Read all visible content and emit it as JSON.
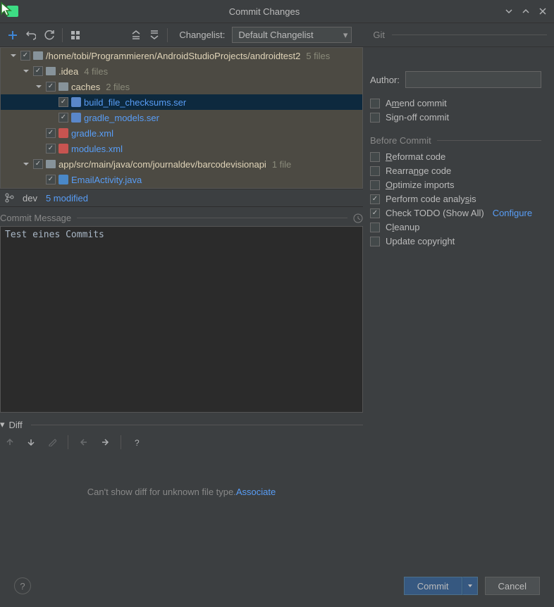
{
  "window": {
    "title": "Commit Changes"
  },
  "toolbar": {
    "changelist_label": "Changelist:",
    "changelist_value": "Default Changelist",
    "git_label": "Git"
  },
  "tree": {
    "rows": [
      {
        "indent": 0,
        "expand": "down",
        "check": true,
        "iconType": "folder",
        "name": "/home/tobi/Programmieren/AndroidStudioProjects/androidtest2",
        "count": "5 files",
        "link": false,
        "nameIcon": "folder"
      },
      {
        "indent": 1,
        "expand": "down",
        "check": true,
        "iconType": "folder",
        "name": ".idea",
        "count": "4 files",
        "link": false
      },
      {
        "indent": 2,
        "expand": "down",
        "check": true,
        "iconType": "folder",
        "name": "caches",
        "count": "2 files",
        "link": false
      },
      {
        "indent": 3,
        "expand": "",
        "check": true,
        "iconType": "ser",
        "name": "build_file_checksums.ser",
        "count": "",
        "link": true,
        "selected": true
      },
      {
        "indent": 3,
        "expand": "",
        "check": true,
        "iconType": "ser",
        "name": "gradle_models.ser",
        "count": "",
        "link": true
      },
      {
        "indent": 2,
        "expand": "",
        "check": true,
        "iconType": "xml",
        "name": "gradle.xml",
        "count": "",
        "link": true
      },
      {
        "indent": 2,
        "expand": "",
        "check": true,
        "iconType": "xml",
        "name": "modules.xml",
        "count": "",
        "link": true
      },
      {
        "indent": 1,
        "expand": "down",
        "check": true,
        "iconType": "folder",
        "name": "app/src/main/java/com/journaldev/barcodevisionapi",
        "count": "1 file",
        "link": false
      },
      {
        "indent": 2,
        "expand": "",
        "check": true,
        "iconType": "java",
        "name": "EmailActivity.java",
        "count": "",
        "link": true
      }
    ]
  },
  "status": {
    "branch": "dev",
    "modified": "5 modified"
  },
  "commit_message": {
    "label": "Commit Message",
    "value": "Test eines Commits"
  },
  "diff": {
    "label": "Diff",
    "unknown_text": "Can't show diff for unknown file type. ",
    "associate": "Associate"
  },
  "git_panel": {
    "author_label": "Author:",
    "author_value": "",
    "amend": "Amend commit",
    "signoff": "Sign-off commit",
    "before_commit": "Before Commit",
    "reformat": "Reformat code",
    "rearrange": "Rearrange code",
    "optimize": "Optimize imports",
    "analysis": "Perform code analysis",
    "todo": "Check TODO (Show All)",
    "configure": "Configure",
    "cleanup": "Cleanup",
    "copyright": "Update copyright"
  },
  "footer": {
    "commit": "Commit",
    "cancel": "Cancel"
  }
}
